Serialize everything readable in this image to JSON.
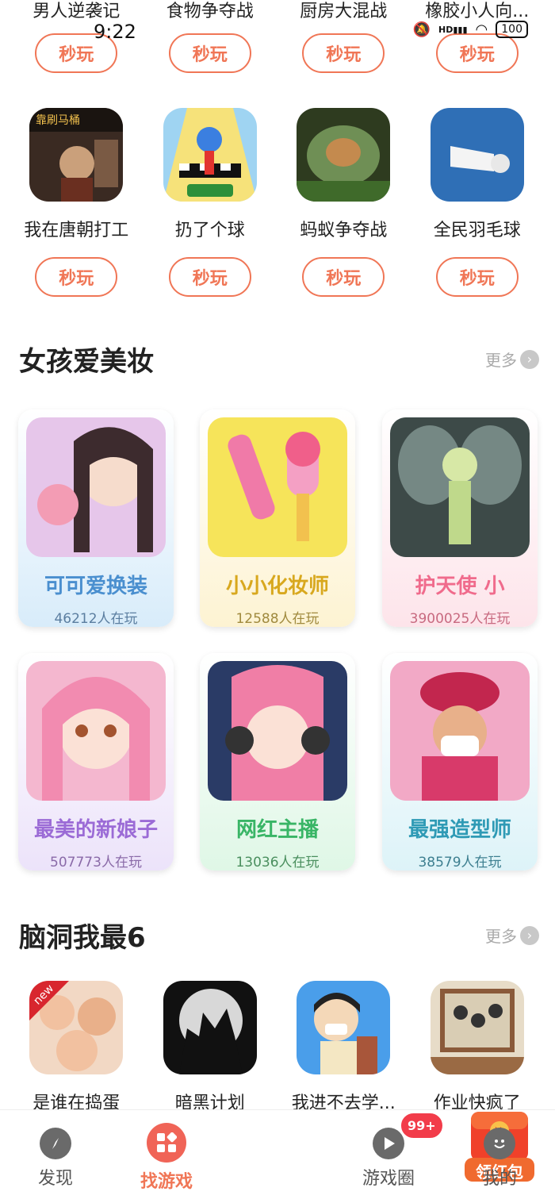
{
  "status_bar": {
    "time": "9:22",
    "battery": "100"
  },
  "top_row_partial": [
    {
      "name": "男人逆袭记",
      "play": "秒玩"
    },
    {
      "name": "食物争夺战",
      "play": "秒玩"
    },
    {
      "name": "厨房大混战",
      "play": "秒玩"
    },
    {
      "name": "橡胶小人向...",
      "play": "秒玩"
    }
  ],
  "second_row": [
    {
      "name": "我在唐朝打工",
      "play": "秒玩",
      "icon": "tang-dynasty-icon"
    },
    {
      "name": "扔了个球",
      "play": "秒玩",
      "icon": "runner-ball-icon"
    },
    {
      "name": "蚂蚁争夺战",
      "play": "秒玩",
      "icon": "ant-nest-icon"
    },
    {
      "name": "全民羽毛球",
      "play": "秒玩",
      "icon": "shuttlecock-icon"
    }
  ],
  "section_makeup": {
    "title": "女孩爱美妆",
    "more": "更多"
  },
  "makeup_cards": [
    {
      "title": "可可爱换装",
      "players": "46212人在玩",
      "bg": "#d8ecfa",
      "title_color": "#4a8fcf"
    },
    {
      "title": "小小化妆师",
      "players": "12588人在玩",
      "bg": "#fdf3d2",
      "title_color": "#d8a81e"
    },
    {
      "title": "护天使        小",
      "players": "3900025人在玩",
      "bg": "#fde4ea",
      "title_color": "#f06b8c"
    },
    {
      "title": "最美的新娘子",
      "players": "507773人在玩",
      "bg": "#ece3fa",
      "title_color": "#9b6bd6"
    },
    {
      "title": "网红主播",
      "players": "13036人在玩",
      "bg": "#dff7e6",
      "title_color": "#39b566"
    },
    {
      "title": "最强造型师",
      "players": "38579人在玩",
      "bg": "#ddf3f8",
      "title_color": "#2e9ab5"
    }
  ],
  "section_brain": {
    "title": "脑洞我最6",
    "more": "更多"
  },
  "brain_row": [
    {
      "name": "是谁在捣蛋",
      "icon": "cartoon-crowd-icon",
      "tag": "new"
    },
    {
      "name": "暗黑计划",
      "icon": "dark-silhouette-icon"
    },
    {
      "name": "我进不去学...",
      "icon": "student-mask-icon"
    },
    {
      "name": "作业快疯了",
      "icon": "family-photo-icon"
    }
  ],
  "bottom_nav": {
    "discover": "发现",
    "find_games": "找游戏",
    "red_packet": "领红包",
    "game_circle": "游戏圈",
    "game_circle_badge": "99+",
    "mine": "我的"
  }
}
